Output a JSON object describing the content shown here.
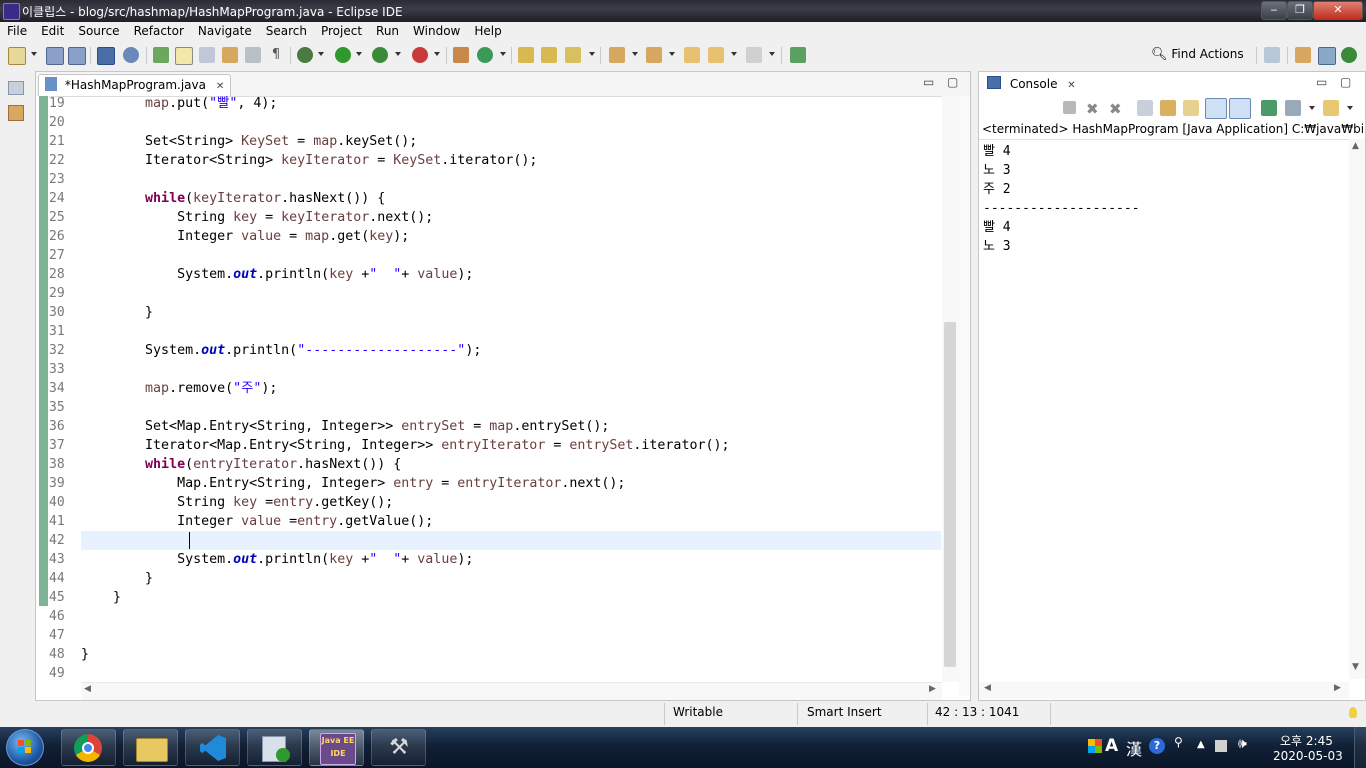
{
  "window": {
    "title": "이클립스 - blog/src/hashmap/HashMapProgram.java - Eclipse IDE",
    "minimize": "‒",
    "maximize": "❐",
    "close": "✕"
  },
  "menu": [
    "File",
    "Edit",
    "Source",
    "Refactor",
    "Navigate",
    "Search",
    "Project",
    "Run",
    "Window",
    "Help"
  ],
  "toolbar": {
    "find_actions": "Find Actions"
  },
  "editor": {
    "tab_label": "*HashMapProgram.java",
    "tab_close": "✕",
    "minimize": "▭",
    "maximize": "▢",
    "lines": [
      {
        "n": "19",
        "html": "        <span class=\"var\">map</span>.put(<span class=\"str\">\"빨\"</span>, 4);"
      },
      {
        "n": "20",
        "html": ""
      },
      {
        "n": "21",
        "html": "        Set&lt;String&gt; <span class=\"var\">KeySet</span> = <span class=\"var\">map</span>.keySet();"
      },
      {
        "n": "22",
        "html": "        Iterator&lt;String&gt; <span class=\"var\">keyIterator</span> = <span class=\"var\">KeySet</span>.iterator();"
      },
      {
        "n": "23",
        "html": ""
      },
      {
        "n": "24",
        "html": "        <span class=\"kw\">while</span>(<span class=\"var\">keyIterator</span>.hasNext()) {"
      },
      {
        "n": "25",
        "html": "            String <span class=\"var\">key</span> = <span class=\"var\">keyIterator</span>.next();"
      },
      {
        "n": "26",
        "html": "            Integer <span class=\"var\">value</span> = <span class=\"var\">map</span>.get(<span class=\"var\">key</span>);"
      },
      {
        "n": "27",
        "html": ""
      },
      {
        "n": "28",
        "html": "            System.<span class=\"fld\">out</span>.println(<span class=\"var\">key</span> +<span class=\"str\">\"  \"</span>+ <span class=\"var\">value</span>);"
      },
      {
        "n": "29",
        "html": ""
      },
      {
        "n": "30",
        "html": "        }"
      },
      {
        "n": "31",
        "html": ""
      },
      {
        "n": "32",
        "html": "        System.<span class=\"fld\">out</span>.println(<span class=\"str\">\"-------------------\"</span>);"
      },
      {
        "n": "33",
        "html": ""
      },
      {
        "n": "34",
        "html": "        <span class=\"var\">map</span>.remove(<span class=\"str\">\"주\"</span>);"
      },
      {
        "n": "35",
        "html": ""
      },
      {
        "n": "36",
        "html": "        Set&lt;Map.Entry&lt;String, Integer&gt;&gt; <span class=\"var\">entrySet</span> = <span class=\"var\">map</span>.entrySet();"
      },
      {
        "n": "37",
        "html": "        Iterator&lt;Map.Entry&lt;String, Integer&gt;&gt; <span class=\"var\">entryIterator</span> = <span class=\"var\">entrySet</span>.iterator();"
      },
      {
        "n": "38",
        "html": "        <span class=\"kw\">while</span>(<span class=\"var\">entryIterator</span>.hasNext()) {"
      },
      {
        "n": "39",
        "html": "            Map.Entry&lt;String, Integer&gt; <span class=\"var\">entry</span> = <span class=\"var\">entryIterator</span>.next();"
      },
      {
        "n": "40",
        "html": "            String <span class=\"var\">key</span> =<span class=\"var\">entry</span>.getKey();"
      },
      {
        "n": "41",
        "html": "            Integer <span class=\"var\">value</span> =<span class=\"var\">entry</span>.getValue();"
      },
      {
        "n": "42",
        "html": ""
      },
      {
        "n": "43",
        "html": "            System.<span class=\"fld\">out</span>.println(<span class=\"var\">key</span> +<span class=\"str\">\"  \"</span>+ <span class=\"var\">value</span>);"
      },
      {
        "n": "44",
        "html": "        }"
      },
      {
        "n": "45",
        "html": "    }"
      },
      {
        "n": "46",
        "html": ""
      },
      {
        "n": "47",
        "html": ""
      },
      {
        "n": "48",
        "html": "}"
      },
      {
        "n": "49",
        "html": ""
      }
    ]
  },
  "console": {
    "tab_label": "Console",
    "tab_close": "✕",
    "minimize": "▭",
    "maximize": "▢",
    "header": "<terminated> HashMapProgram [Java Application] C:₩java₩bin₩javaw",
    "output": [
      "빨 4",
      "노 3",
      "주 2",
      "--------------------",
      "빨 4",
      "노 3"
    ]
  },
  "status": {
    "writable": "Writable",
    "insert_mode": "Smart Insert",
    "position": "42 : 13 : 1041"
  },
  "taskbar": {
    "clock_time": "오후 2:45",
    "clock_date": "2020-05-03",
    "ime_a": "A",
    "ime_han": "漢",
    "eclipse_label": "Java EE IDE"
  },
  "colors": {
    "keyword": "#7f0055",
    "string": "#2a00ff",
    "field": "#0000c0",
    "variable": "#6a3e3e",
    "current_line": "#e8f2fe"
  }
}
